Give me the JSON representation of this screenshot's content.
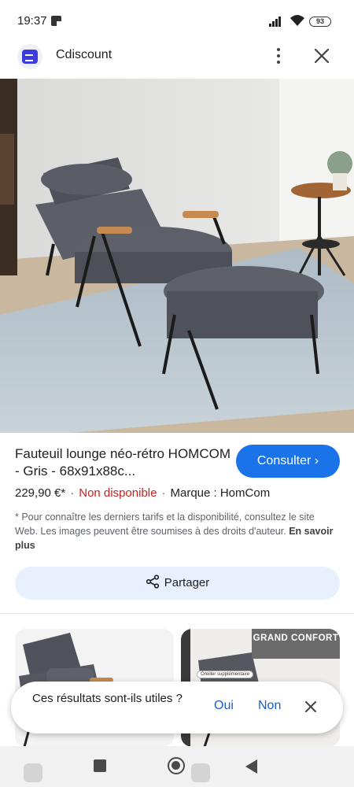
{
  "status_bar": {
    "time": "19:37",
    "battery": "93"
  },
  "header": {
    "title": "Cdiscount",
    "icons": [
      "cdiscount-logo-icon",
      "more-vert-icon",
      "close-icon"
    ]
  },
  "product": {
    "image_subject": "grey lounge armchair with ottoman",
    "title": "Fauteuil lounge néo-rétro HOMCOM - Gris - 68x91x88c...",
    "consult_label": "Consulter ›",
    "price": "229,90 €*",
    "separator": "·",
    "availability": "Non disponible",
    "brand": "Marque : HomCom",
    "disclaimer": "* Pour connaître les derniers tarifs et la disponibilité, consultez le site Web. Les images peuvent être soumises à des droits d'auteur.",
    "learn_more": "En savoir plus"
  },
  "share": {
    "label": "Partager"
  },
  "related": {
    "card2_badge": "GRAND CONFORT",
    "card2_small_label": "Oreiller supplémentaire"
  },
  "feedback": {
    "question": "Ces résultats sont-ils utiles ?",
    "yes": "Oui",
    "no": "Non"
  },
  "colors": {
    "accent": "#1a73e8",
    "unavailable": "#c5221f",
    "share_bg": "#e8f0fe"
  }
}
